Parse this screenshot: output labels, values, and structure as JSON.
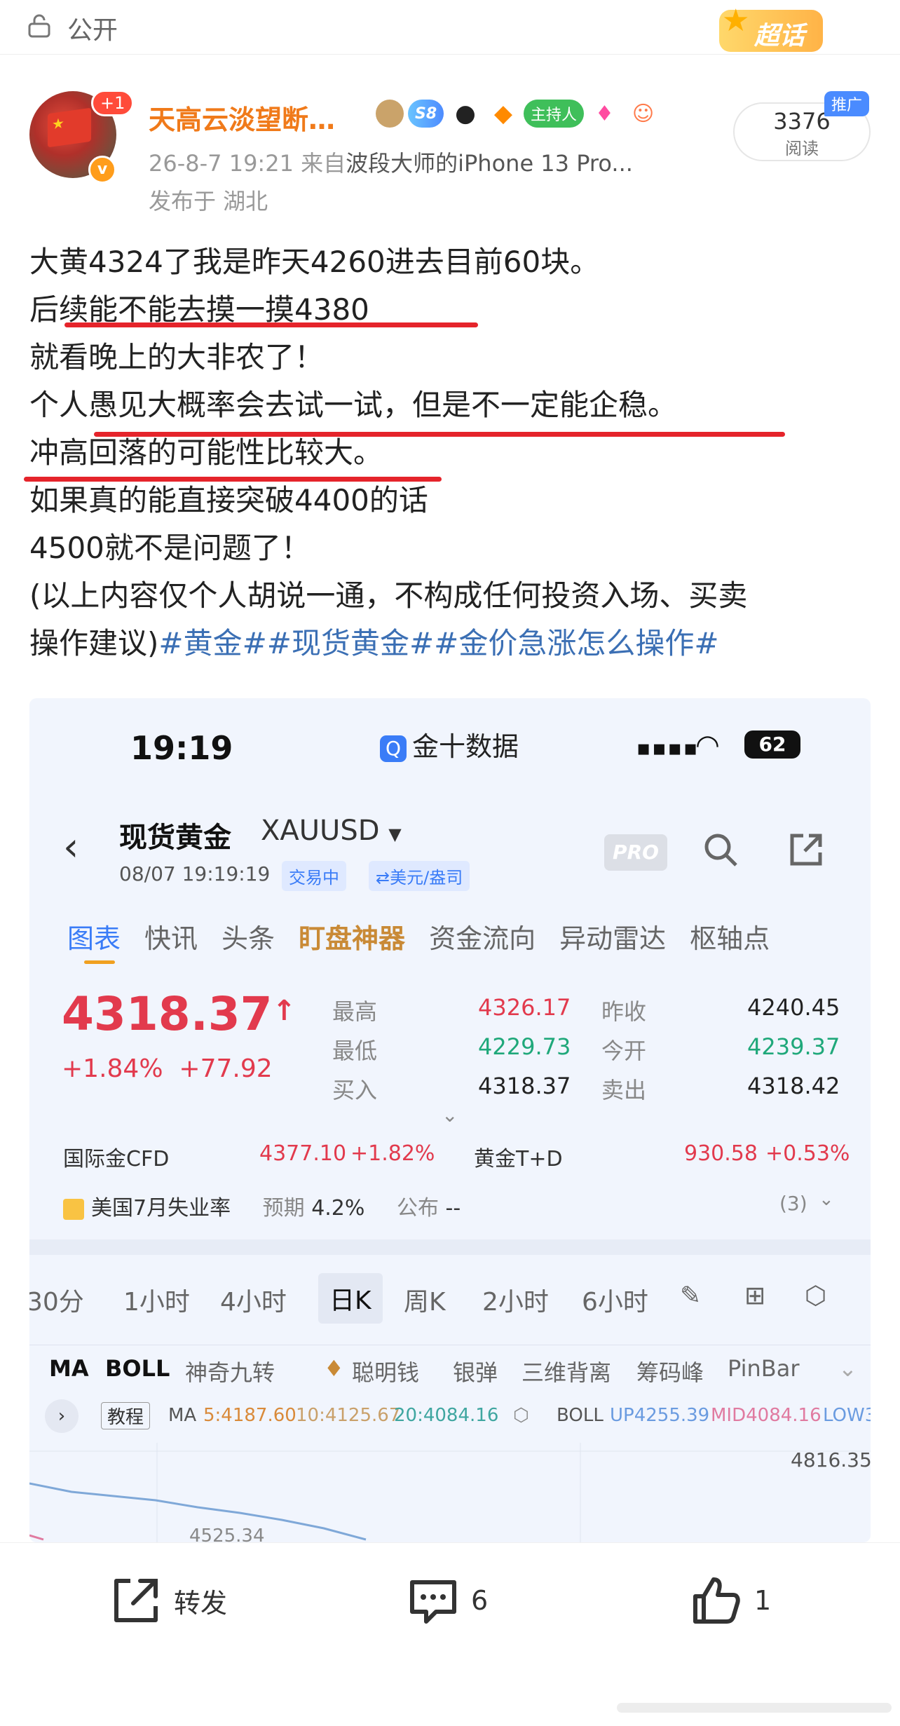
{
  "top": {
    "visibility": "公开",
    "supertopic": "超话"
  },
  "author": {
    "name": "天高云淡望断…",
    "notify_badge": "+1",
    "verified_mark": "v",
    "medal_s8": "S8",
    "medal_host": "主持人",
    "timestamp": "26-8-7 19:21",
    "source_prefix": "来自",
    "source": "波段大师的iPhone 13 Pro...",
    "location": "发布于 湖北",
    "reads": "3376",
    "reads_label": "阅读",
    "promo": "推广"
  },
  "post": {
    "lines": [
      "大黄4324了我是昨天4260进去目前60块。",
      "后续能不能去摸一摸4380",
      "就看晚上的大非农了！",
      "个人愚见大概率会去试一试，但是不一定能企稳。",
      "冲高回落的可能性比较大。",
      "如果真的能直接突破4400的话",
      "4500就不是问题了！",
      "(以上内容仅个人胡说一通，不构成任何投资入场、买卖"
    ],
    "last_line_text": "操作建议)",
    "tags": "#黄金##现货黄金##金价急涨怎么操作#"
  },
  "screenshot": {
    "status_time": "19:19",
    "app_name": "金十数据",
    "app_icon": "Q",
    "battery": "62",
    "instrument_name": "现货黄金",
    "instrument_code": "XAUUSD",
    "instrument_time": "08/07 19:19:19",
    "chip_trading": "交易中",
    "chip_unit": "⇄美元/盎司",
    "pro_label": "PRO",
    "tabs": [
      "图表",
      "快讯",
      "头条",
      "盯盘神器",
      "资金流向",
      "异动雷达",
      "枢轴点"
    ],
    "price": "4318.37",
    "price_arrow": "↑",
    "change_pct": "+1.84%",
    "change_abs": "+77.92",
    "quote": {
      "high_label": "最高",
      "high": "4326.17",
      "low_label": "最低",
      "low": "4229.73",
      "bid_label": "买入",
      "bid": "4318.37",
      "prev_close_label": "昨收",
      "prev_close": "4240.45",
      "open_label": "今开",
      "open": "4239.37",
      "ask_label": "卖出",
      "ask": "4318.42"
    },
    "cfd_label": "国际金CFD",
    "cfd_value": "4377.10",
    "cfd_change": "+1.82%",
    "td_label": "黄金T+D",
    "td_value": "930.58",
    "td_change": "+0.53%",
    "econ_event": "美国7月失业率",
    "econ_expect_label": "预期",
    "econ_expect": "4.2%",
    "econ_actual_label": "公布",
    "econ_actual": "--",
    "econ_count": "(3)",
    "periods": [
      "30分",
      "1小时",
      "4小时",
      "日K",
      "周K",
      "2小时",
      "6小时"
    ],
    "indicators": [
      "MA",
      "BOLL",
      "神奇九转",
      "聪明钱",
      "银弹",
      "三维背离",
      "筹码峰",
      "PinBar"
    ],
    "tutorial": "教程",
    "ma_label": "MA",
    "ma5": "5:4187.60",
    "ma10": "10:4125.67",
    "ma20": "20:4084.16",
    "boll_label": "BOLL",
    "boll_up": "UP4255.39",
    "boll_mid": "MID4084.16",
    "boll_low": "LOW3",
    "chart_high": "4816.35",
    "chart_low_partial": "4525.34"
  },
  "actions": {
    "repost": "转发",
    "comments": "6",
    "likes": "1"
  },
  "colors": {
    "accent": "#3a7cf7",
    "up": "#e23a4d",
    "down": "#1fa87a",
    "username": "#f07a1a",
    "underline": "#e5242b"
  }
}
